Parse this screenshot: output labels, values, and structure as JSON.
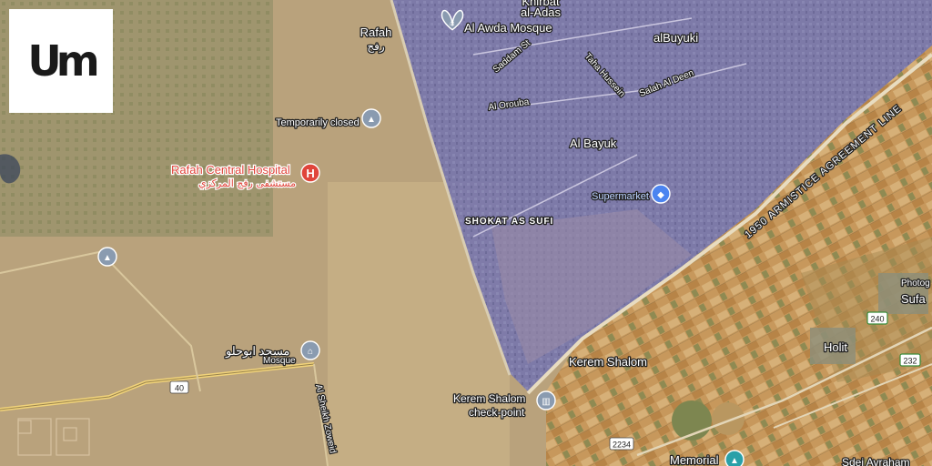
{
  "logo": {
    "text": "Um"
  },
  "places": {
    "rafah": "Rafah",
    "rafah_ar": "رفح",
    "khirbat": "Khirbat",
    "al_adas": "al-Adas",
    "awda_mosque": "Al Awda Mosque",
    "albuyuki": "alBuyuki",
    "saddam_st": "Saddam St",
    "taha_hussein": "Taha Hussein",
    "salah_al_deen": "Salah Al Deen",
    "al_orouba": "Al Orouba",
    "al_bayuk": "Al Bayuk",
    "temporarily_closed": "Temporarily closed",
    "hospital": "Rafah Central Hospital",
    "hospital_ar": "مستشفى رفح المركزي",
    "supermarket": "Supermarket",
    "shokat": "SHOKAT AS SUFI",
    "armistice": "1950 ARMISTICE AGREEMENT LINE",
    "photog": "Photog",
    "sufa": "Sufa",
    "holit": "Holit",
    "mosque_ar": "مسجد ابوحلو",
    "mosque": "Mosque",
    "kerem_shalom": "Kerem Shalom",
    "kerem_checkpoint_1": "Kerem Shalom",
    "kerem_checkpoint_2": "check-point",
    "al_sheikh_zoweid": "Al Sheikh Zoweid",
    "memorial": "Memorial",
    "sdei_avraham": "Sdei Avraham"
  },
  "road_shields": {
    "r40": "40",
    "r240": "240",
    "r232": "232",
    "r2234": "2234"
  },
  "colors": {
    "desert": "#b9a27c",
    "gaza_overlay": "#6f70b8",
    "fields": "#c9a063",
    "marker_gray": "#8a9bb0",
    "marker_blue": "#4b84f0",
    "marker_red": "#e0453b",
    "road_yellow": "#f1d37a"
  },
  "icons": {
    "mosque_marker": "mosque-marker-icon",
    "school_marker": "school-marker-icon",
    "hospital_marker": "hospital-marker-icon",
    "shopping_marker": "shopping-cart-marker-icon",
    "landmark_marker": "landmark-marker-icon"
  }
}
